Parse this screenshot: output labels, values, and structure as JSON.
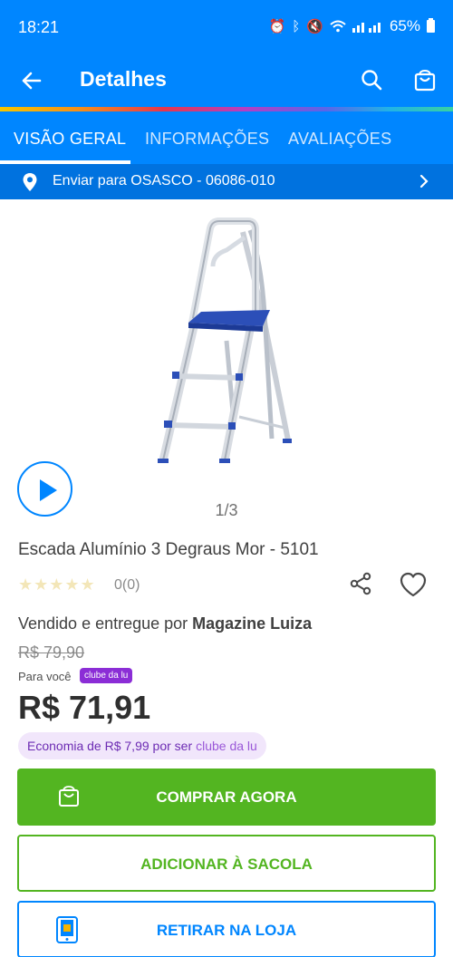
{
  "status_bar": {
    "time": "18:21",
    "battery": "65%",
    "icons": [
      "alarm-icon",
      "bluetooth-icon",
      "mute-icon",
      "wifi-icon",
      "volte-icon",
      "signal-icon",
      "battery-icon"
    ],
    "volte_label": "Vo))\nLTE1"
  },
  "app_bar": {
    "title": "Detalhes",
    "back_icon": "arrow-left-icon",
    "search_icon": "search-icon",
    "bag_icon": "shopping-bag-icon"
  },
  "tabs": [
    {
      "label": "VISÃO GERAL",
      "active": true
    },
    {
      "label": "INFORMAÇÕES",
      "active": false
    },
    {
      "label": "AVALIAÇÕES",
      "active": false
    }
  ],
  "shipping": {
    "text": "Enviar para OSASCO - 06086-010"
  },
  "product": {
    "image_counter": "1/3",
    "title": "Escada Alumínio 3 Degraus Mor  - 5101",
    "stars": "★★★★★",
    "rating_value": 0,
    "rating_count": "0(0)",
    "seller_prefix": "Vendido e entregue por ",
    "seller_name": "Magazine Luiza",
    "old_price": "R$ 79,90",
    "for_you_label": "Para você",
    "clube_badge": "clube da lu",
    "price": "R$ 71,91",
    "economy_text": "Economia de R$ 7,99 por ser",
    "economy_clube": "clube da lu"
  },
  "buttons": {
    "buy_now": "COMPRAR AGORA",
    "add_to_bag": "ADICIONAR À SACOLA",
    "pickup_store": "RETIRAR NA LOJA"
  },
  "colors": {
    "primary_blue": "#0086ff",
    "shipping_blue": "#0072df",
    "buy_green": "#53b521",
    "clube_purple": "#8b2dd6"
  }
}
